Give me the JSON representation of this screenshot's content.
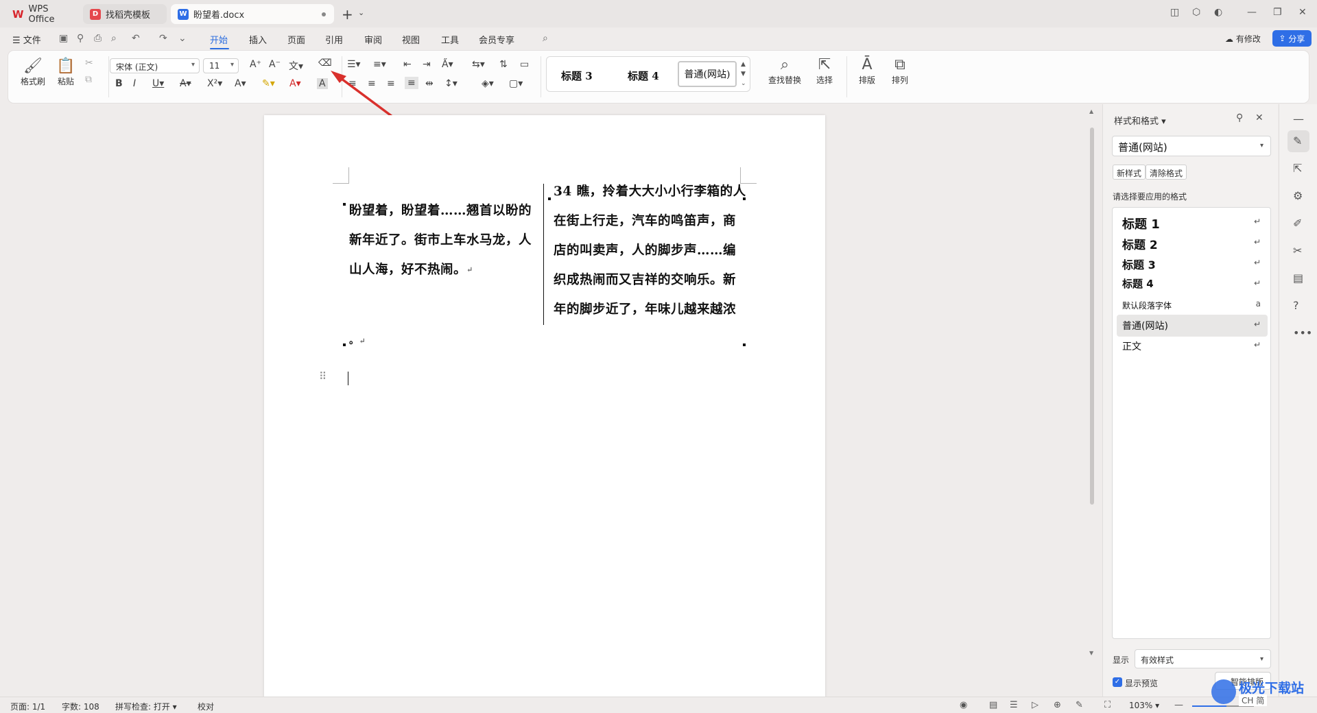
{
  "tabs": [
    {
      "label": "WPS Office",
      "icon": "wps-logo-icon"
    },
    {
      "label": "找稻壳模板",
      "icon": "docer-icon"
    },
    {
      "label": "盼望着.docx",
      "icon": "word-doc-icon"
    }
  ],
  "menu": {
    "file": "文件",
    "items": [
      "开始",
      "插入",
      "页面",
      "引用",
      "审阅",
      "视图",
      "工具",
      "会员专享"
    ],
    "active": "开始",
    "modified": "有修改",
    "share": "分享"
  },
  "ribbon": {
    "format_painter": "格式刷",
    "paste": "粘贴",
    "font_name": "宋体 (正文)",
    "font_size": "11",
    "find_replace": "查找替换",
    "select": "选择",
    "typeset": "排版",
    "arrange": "排列",
    "styles": [
      "标题 3",
      "标题 4",
      "普通(网站)"
    ]
  },
  "document": {
    "left_column": [
      "盼望着，盼望着……翘首以盼的",
      "新年近了。街市上车水马龙，人",
      "山人海，好不热闹。"
    ],
    "right_column": [
      "34 瞧，拎着大大小小行李箱的人",
      "在街上行走，汽车的鸣笛声，商",
      "店的叫卖声，人的脚步声……编",
      "织成热闹而又吉祥的交响乐。新",
      "年的脚步近了，年味儿越来越浓"
    ],
    "tail": "。"
  },
  "panel": {
    "title": "样式和格式",
    "current_style": "普通(网站)",
    "new_style": "新样式",
    "clear_format": "清除格式",
    "apply_label": "请选择要应用的格式",
    "styles": [
      {
        "name": "标题 1",
        "mark": "↵"
      },
      {
        "name": "标题 2",
        "mark": "↵"
      },
      {
        "name": "标题 3",
        "mark": "↵"
      },
      {
        "name": "标题 4",
        "mark": "↵"
      },
      {
        "name": "默认段落字体",
        "mark": "a"
      },
      {
        "name": "普通(网站)",
        "mark": "↵"
      },
      {
        "name": "正文",
        "mark": "↵"
      }
    ],
    "show_label": "显示",
    "show_value": "有效样式",
    "preview_label": "显示预览",
    "smart_typeset": "智能排版"
  },
  "status": {
    "page": "页面: 1/1",
    "words": "字数: 108",
    "spell": "拼写检查: 打开",
    "proof": "校对",
    "zoom": "103%"
  },
  "watermark": {
    "title": "极光下载站",
    "sub": "CH 简"
  },
  "colors": {
    "accent": "#2a6cdf",
    "annotation_arrow": "#d9302c"
  }
}
